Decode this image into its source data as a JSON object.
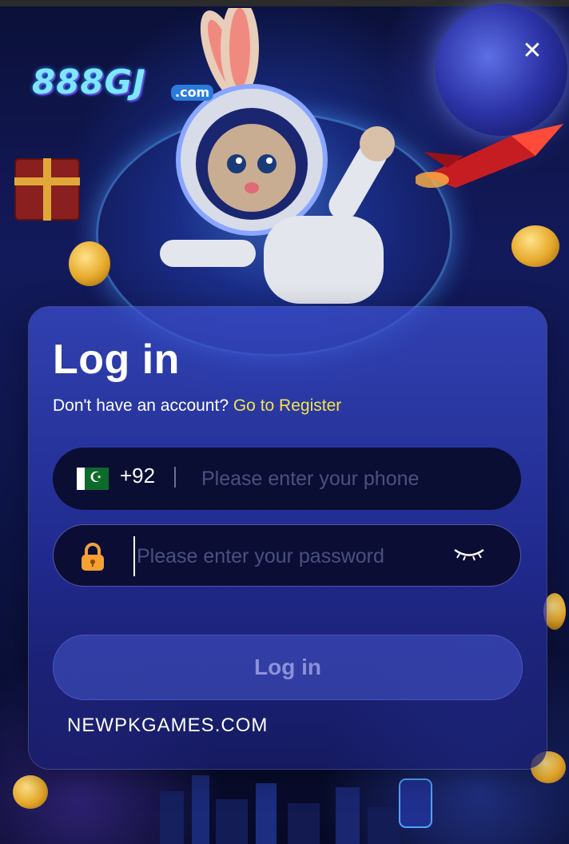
{
  "window": {
    "close_icon": "close-icon"
  },
  "brand": {
    "logo_main": "888GJ",
    "logo_sub": ".com"
  },
  "login": {
    "title": "Log in",
    "no_account_text": "Don't have an account?",
    "register_link": "Go to Register",
    "phone": {
      "country_code": "+92",
      "flag": "pakistan-flag-icon",
      "placeholder": "Please enter your phone",
      "value": ""
    },
    "password": {
      "placeholder": "Please enter your password",
      "value": "",
      "visibility_icon": "eye-closed-icon"
    },
    "submit_label": "Log in"
  },
  "watermark": "NEWPKGAMES.COM",
  "colors": {
    "accent_link": "#f3e24e",
    "field_bg": "#0b0e33",
    "card_bg": "#3a47c8"
  }
}
